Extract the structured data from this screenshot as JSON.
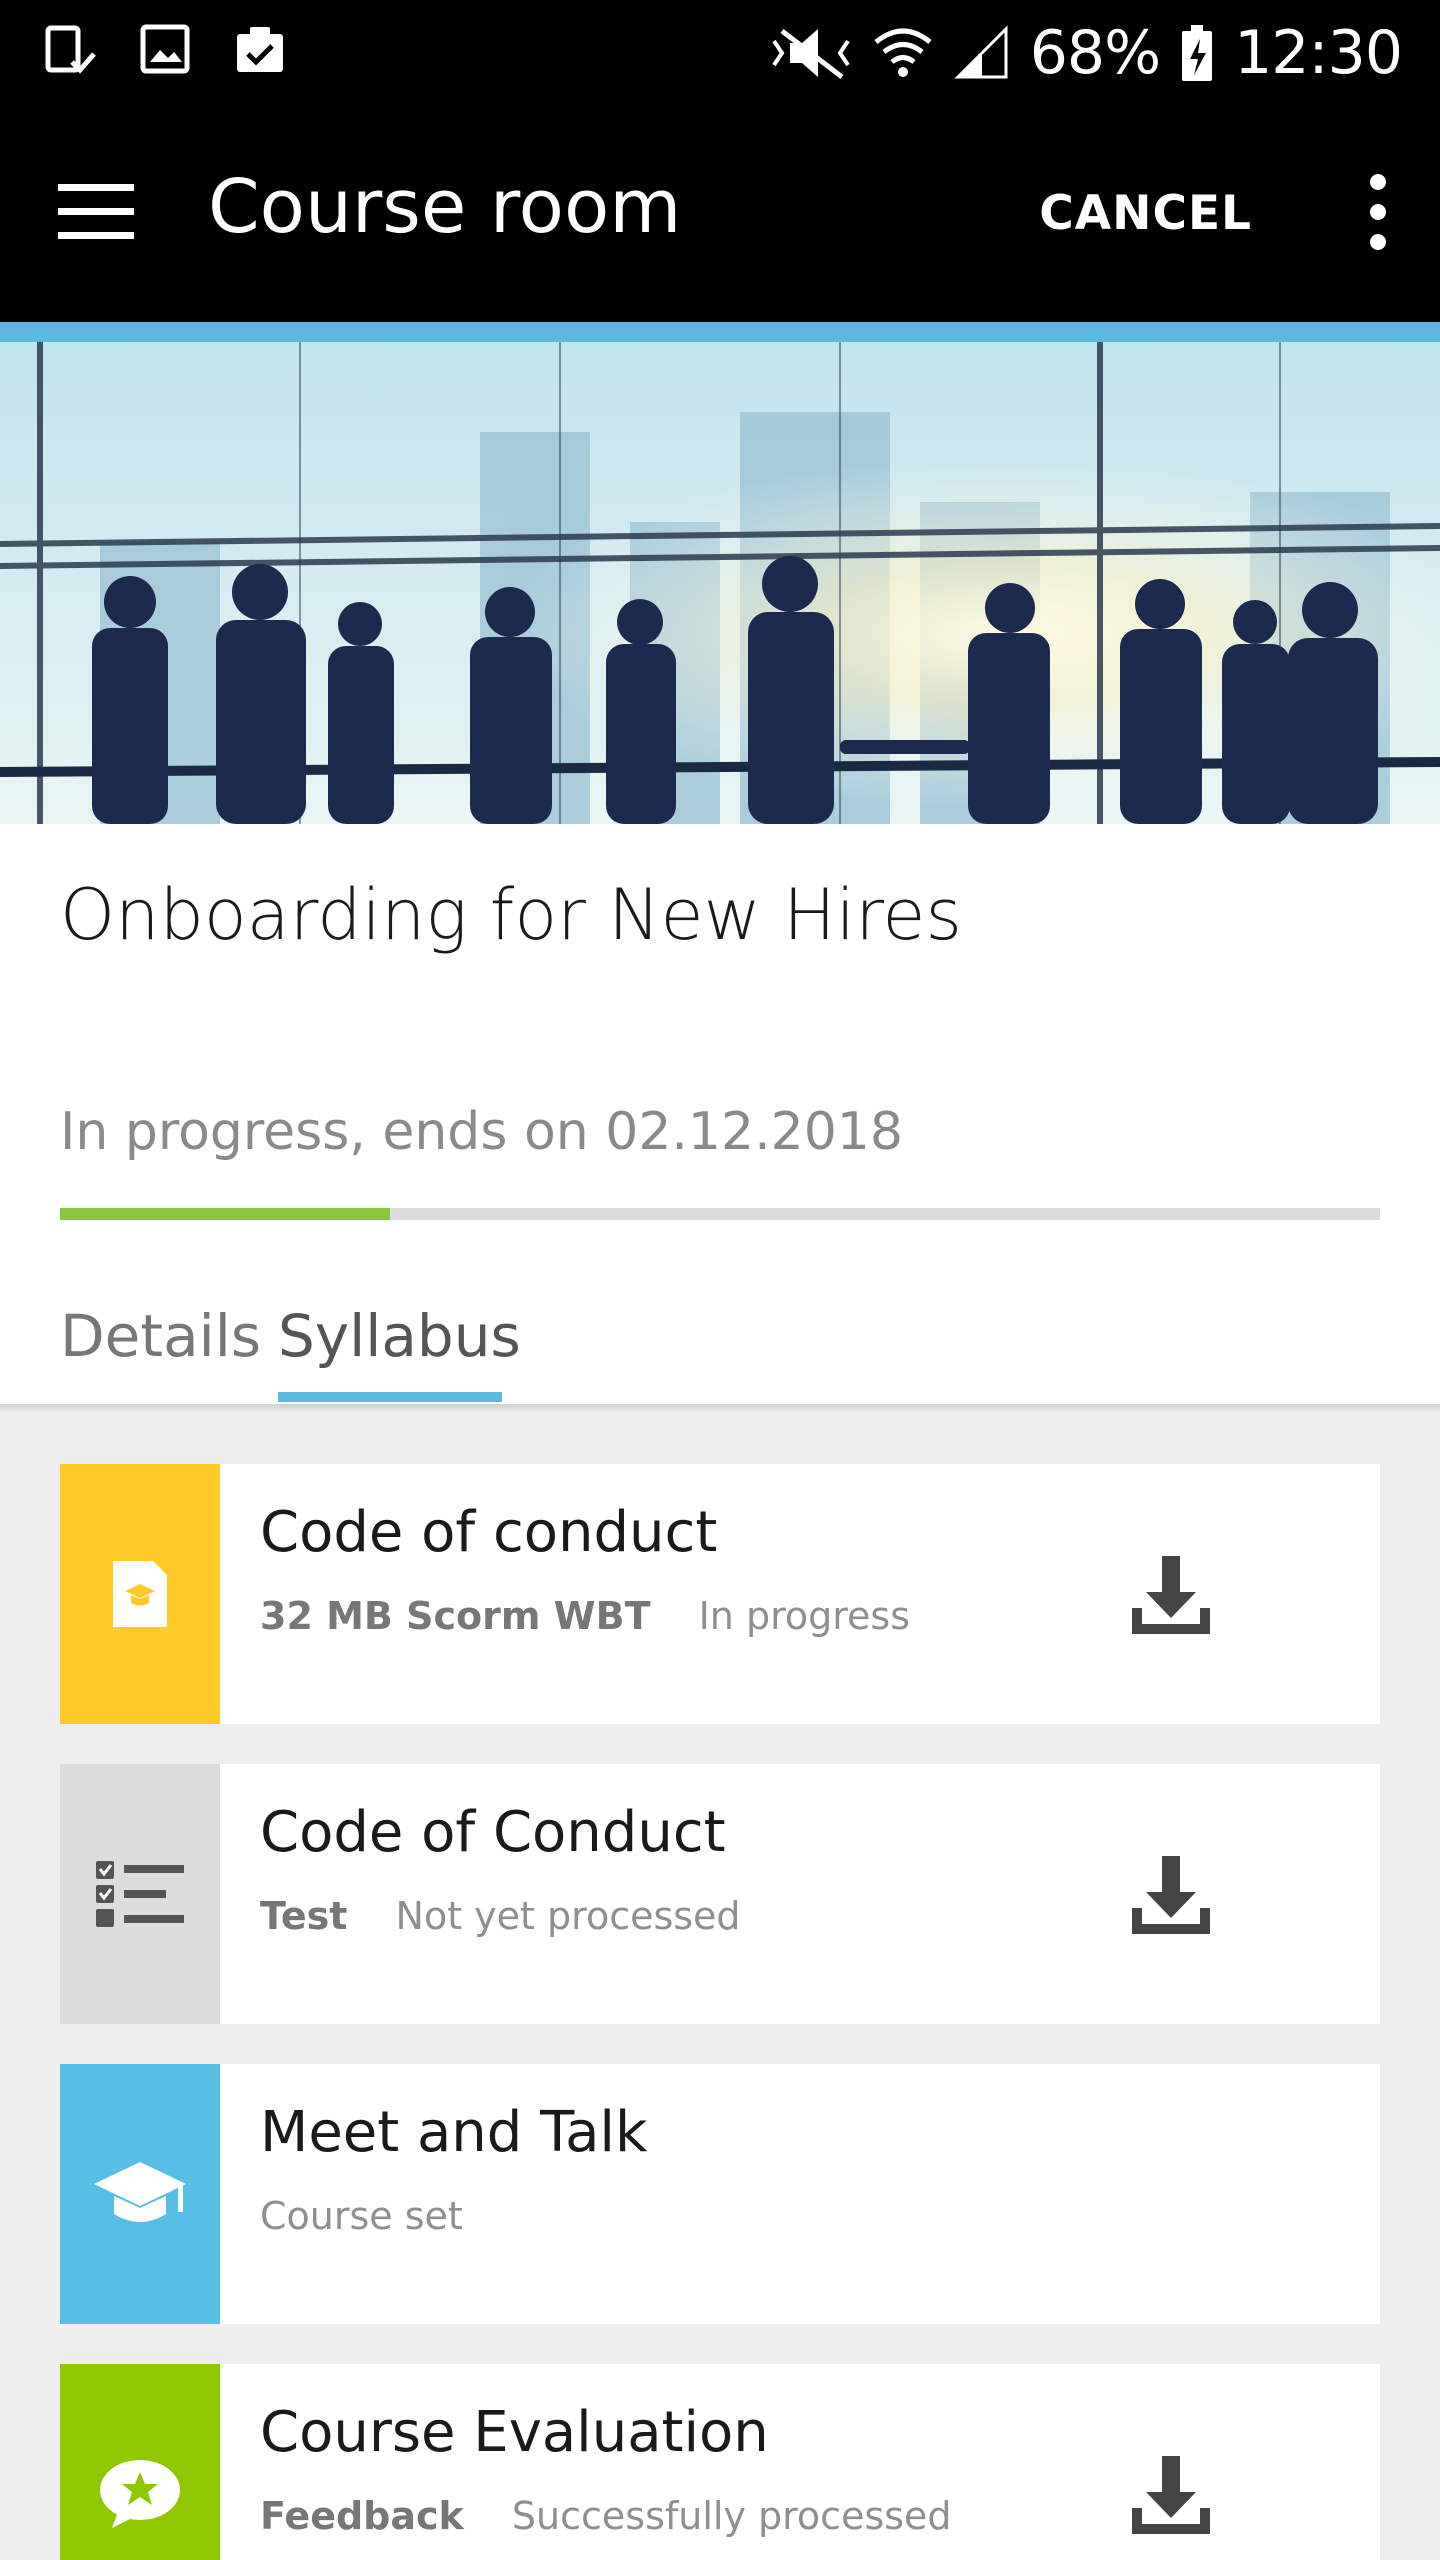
{
  "status_bar": {
    "battery": "68%",
    "time": "12:30",
    "icons": [
      "device-check-icon",
      "image-icon",
      "clipboard-check-icon",
      "mute-icon",
      "wifi-icon",
      "signal-icon",
      "battery-charging-icon"
    ]
  },
  "app_bar": {
    "title": "Course room",
    "cancel_label": "CANCEL",
    "menu_icon": "hamburger-menu-icon",
    "more_icon": "more-vertical-icon"
  },
  "course": {
    "title": "Onboarding for New Hires",
    "status": "In progress, ends on 02.12.2018",
    "progress_fraction": 0.25
  },
  "tabs": [
    {
      "label": "Details",
      "selected": false
    },
    {
      "label": "Syllabus",
      "selected": true
    }
  ],
  "syllabus": [
    {
      "title": "Code of conduct",
      "type": "32 MB Scorm WBT",
      "state": "In progress",
      "icon": "scorm-document-icon",
      "color": "#ffca28",
      "downloadable": true
    },
    {
      "title": "Code of Conduct",
      "type": "Test",
      "state": "Not yet processed",
      "icon": "checklist-icon",
      "color": "#dddddd",
      "downloadable": true
    },
    {
      "title": "Meet and Talk",
      "subtitle": "Course set",
      "icon": "graduation-cap-icon",
      "color": "#57bfe6",
      "downloadable": false
    },
    {
      "title": "Course Evaluation",
      "type": "Feedback",
      "state": "Successfully processed",
      "icon": "feedback-star-icon",
      "color": "#8fc700",
      "downloadable": true
    }
  ],
  "colors": {
    "accent": "#5cb8dc",
    "progress": "#8cc63f"
  }
}
